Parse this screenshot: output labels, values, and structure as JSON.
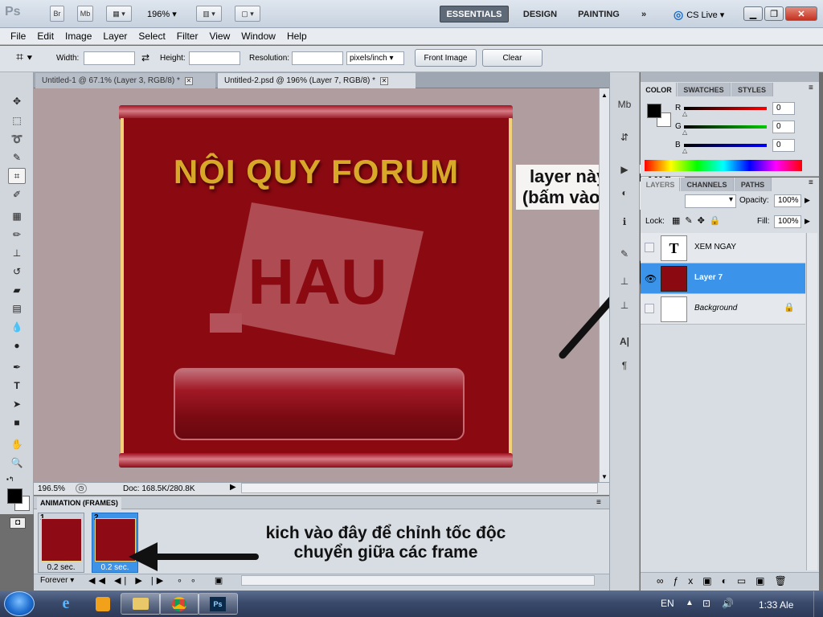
{
  "app": {
    "logo": "Ps",
    "br_label": "Br",
    "mb_label": "Mb",
    "zoom": "196%",
    "workspaces": [
      "ESSENTIALS",
      "DESIGN",
      "PAINTING"
    ],
    "cs_live": "CS Live"
  },
  "menu": [
    "File",
    "Edit",
    "Image",
    "Layer",
    "Select",
    "Filter",
    "View",
    "Window",
    "Help"
  ],
  "options": {
    "width_label": "Width:",
    "height_label": "Height:",
    "resolution_label": "Resolution:",
    "units": "pixels/inch",
    "front_image": "Front Image",
    "clear": "Clear"
  },
  "tabs": [
    {
      "label": "Untitled-1 @ 67.1% (Layer 3, RGB/8) *"
    },
    {
      "label": "Untitled-2.psd @ 196% (Layer 7, RGB/8) *"
    }
  ],
  "artwork": {
    "title": "NỘI QUY FORUM",
    "logo_text": "HAU"
  },
  "status": {
    "zoom": "196.5%",
    "doc": "Doc: 168.5K/280.8K"
  },
  "annotations": {
    "layer_note_line1": "layer này tắt chữ",
    "layer_note_line2": "(bấm vào con mắt)",
    "frame_note_line1": "kich vào đây để chỉnh tốc độc",
    "frame_note_line2": "chuyển giữa các frame"
  },
  "animation": {
    "title": "ANIMATION (FRAMES)",
    "frames": [
      {
        "number": "1",
        "time": "0.2 sec."
      },
      {
        "number": "2",
        "time": "0.2 sec."
      }
    ],
    "loop": "Forever"
  },
  "color_panel": {
    "tabs": [
      "COLOR",
      "SWATCHES",
      "STYLES"
    ],
    "channels": [
      {
        "label": "R",
        "value": "0"
      },
      {
        "label": "G",
        "value": "0"
      },
      {
        "label": "B",
        "value": "0"
      }
    ]
  },
  "layers_panel": {
    "tabs": [
      "LAYERS",
      "CHANNELS",
      "PATHS"
    ],
    "opacity_label": "Opacity:",
    "opacity": "100%",
    "lock_label": "Lock:",
    "fill_label": "Fill:",
    "fill": "100%",
    "layers": [
      {
        "name": "XEM NGAY",
        "type": "text"
      },
      {
        "name": "Layer 7",
        "type": "image"
      },
      {
        "name": "Background",
        "type": "background"
      }
    ]
  },
  "taskbar": {
    "language": "EN",
    "clock": "1:33 Ale",
    "ps_label": "Ps"
  },
  "colors": {
    "accent": "#3b94ea",
    "art_red": "#8b0a12",
    "art_gold": "#d8a928"
  }
}
